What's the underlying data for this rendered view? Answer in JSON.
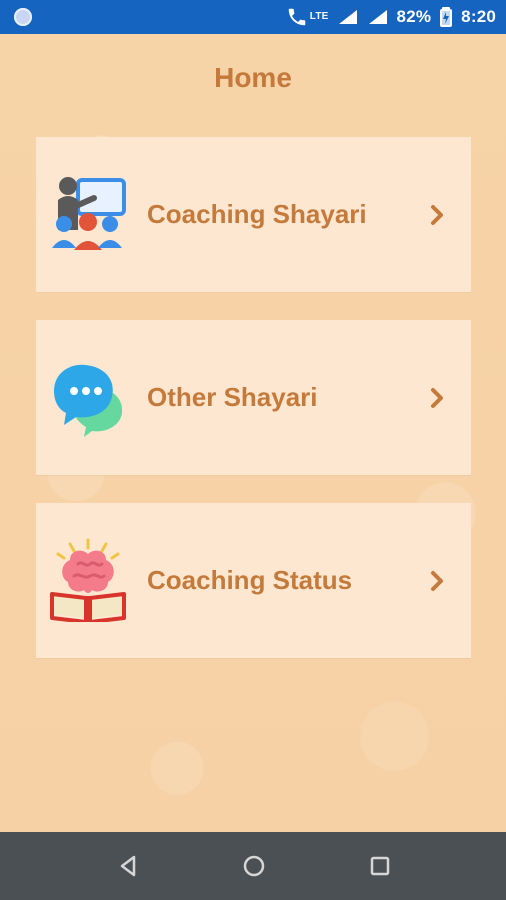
{
  "status_bar": {
    "net_label": "LTE",
    "battery_percent": "82%",
    "time": "8:20"
  },
  "header": {
    "title": "Home"
  },
  "menu": {
    "items": [
      {
        "label": "Coaching Shayari",
        "icon": "presentation-teacher-icon"
      },
      {
        "label": "Other Shayari",
        "icon": "chat-bubbles-icon"
      },
      {
        "label": "Coaching Status",
        "icon": "brain-book-icon"
      }
    ]
  },
  "nav_bar": {
    "back": "back-icon",
    "home": "home-icon",
    "recents": "recents-icon"
  },
  "colors": {
    "status_bar_bg": "#1565c0",
    "page_bg": "#f7d3a8",
    "card_bg": "#fde7d1",
    "accent_text": "#c47a3a",
    "nav_bar_bg": "#4b5054"
  }
}
